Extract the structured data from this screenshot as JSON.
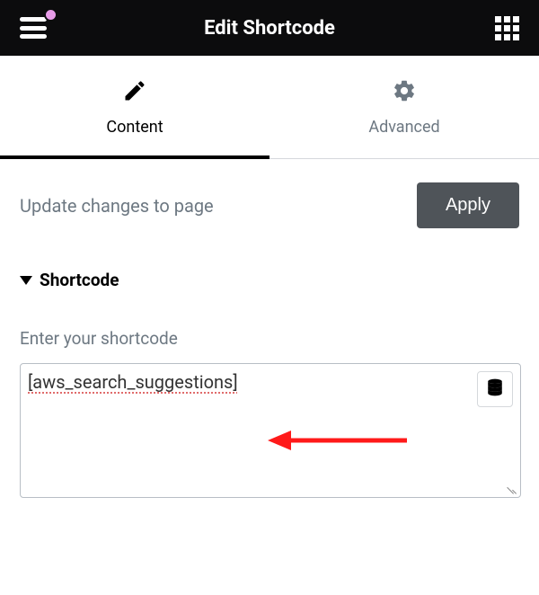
{
  "header": {
    "title": "Edit Shortcode"
  },
  "tabs": [
    {
      "label": "Content",
      "active": true
    },
    {
      "label": "Advanced",
      "active": false
    }
  ],
  "update": {
    "text": "Update changes to page",
    "button": "Apply"
  },
  "section": {
    "title": "Shortcode"
  },
  "field": {
    "label": "Enter your shortcode",
    "value": "[aws_search_suggestions]"
  },
  "annotation": {
    "arrow_target": "shortcode value"
  }
}
